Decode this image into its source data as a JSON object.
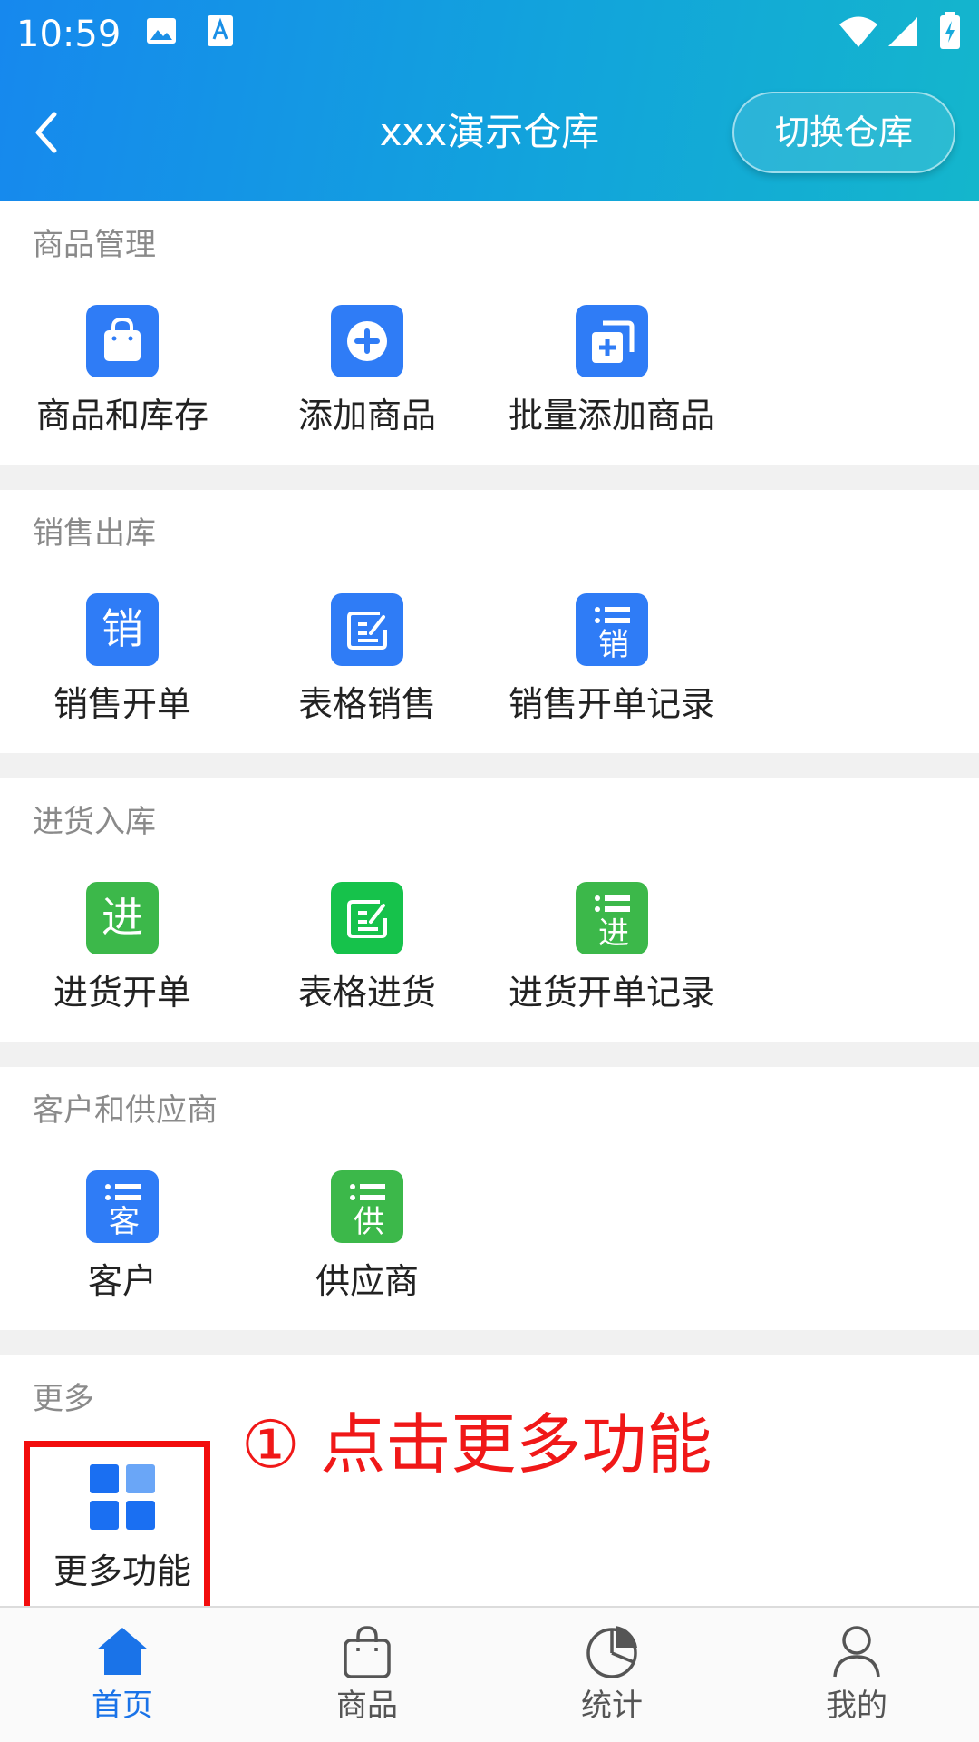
{
  "status_bar": {
    "time": "10:59"
  },
  "header": {
    "title": "xxx演示仓库",
    "switch_label": "切换仓库"
  },
  "sections": [
    {
      "title": "商品管理",
      "items": [
        {
          "label": "商品和库存",
          "icon": "shopping-bag-icon"
        },
        {
          "label": "添加商品",
          "icon": "plus-circle-icon"
        },
        {
          "label": "批量添加商品",
          "icon": "batch-add-icon"
        }
      ]
    },
    {
      "title": "销售出库",
      "items": [
        {
          "label": "销售开单",
          "icon": "sales-order-icon",
          "glyph": "销"
        },
        {
          "label": "表格销售",
          "icon": "table-edit-icon"
        },
        {
          "label": "销售开单记录",
          "icon": "sales-record-icon",
          "glyph": "销"
        }
      ]
    },
    {
      "title": "进货入库",
      "items": [
        {
          "label": "进货开单",
          "icon": "purchase-order-icon",
          "glyph": "进"
        },
        {
          "label": "表格进货",
          "icon": "table-edit-icon"
        },
        {
          "label": "进货开单记录",
          "icon": "purchase-record-icon",
          "glyph": "进"
        }
      ]
    },
    {
      "title": "客户和供应商",
      "items": [
        {
          "label": "客户",
          "icon": "customer-list-icon",
          "glyph": "客"
        },
        {
          "label": "供应商",
          "icon": "supplier-list-icon",
          "glyph": "供"
        }
      ]
    },
    {
      "title": "更多",
      "items": [
        {
          "label": "更多功能",
          "icon": "grid-icon"
        }
      ]
    }
  ],
  "annotation": "① 点击更多功能",
  "bottom_nav": [
    {
      "label": "首页",
      "icon": "home-icon",
      "active": true
    },
    {
      "label": "商品",
      "icon": "shopping-bag-icon",
      "active": false
    },
    {
      "label": "统计",
      "icon": "pie-chart-icon",
      "active": false
    },
    {
      "label": "我的",
      "icon": "user-icon",
      "active": false
    }
  ],
  "colors": {
    "header_start": "#1688ee",
    "header_end": "#14b6cc",
    "blue_icon": "#2f7cf6",
    "green_icon": "#3cb84a",
    "active_nav": "#1a73e8",
    "annotation": "#f01818"
  }
}
